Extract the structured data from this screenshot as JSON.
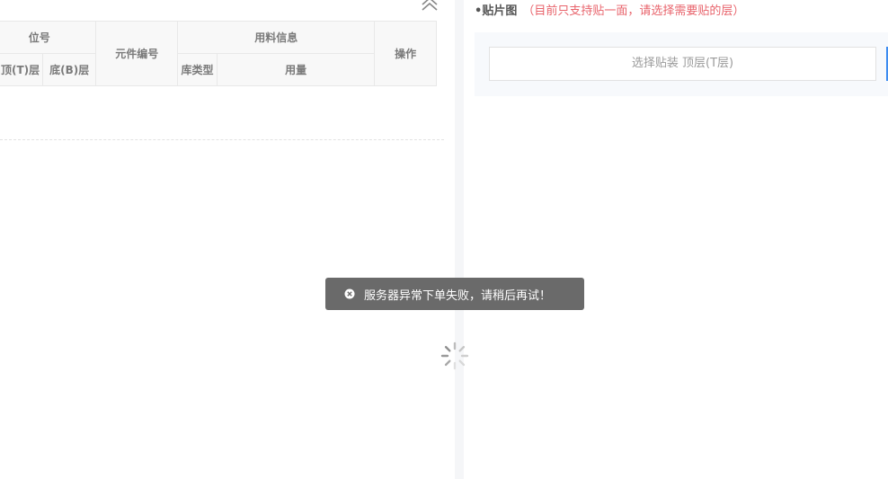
{
  "bom_table": {
    "header": {
      "position": "位号",
      "top_layer": "顶(T)层",
      "bottom_layer": "底(B)层",
      "part_number": "元件编号",
      "material_info": "用料信息",
      "warehouse_type": "库类型",
      "quantity": "用量",
      "actions": "操作"
    }
  },
  "placement": {
    "bullet": "•",
    "title": "贴片图",
    "note": "（目前只支持贴一面，请选择需要贴的层）",
    "select_label": "选择贴装 顶层(T层)"
  },
  "toast": {
    "message": "服务器异常下单失败，请稍后再试！"
  },
  "icons": {
    "collapse": "double-chevron-up-icon",
    "toast": "close-circle-icon",
    "loading": "loading-spinner-icon"
  },
  "colors": {
    "note_red": "#e8636b",
    "toast_bg": "#6a6a6a",
    "accent_blue": "#3d8cf0"
  }
}
